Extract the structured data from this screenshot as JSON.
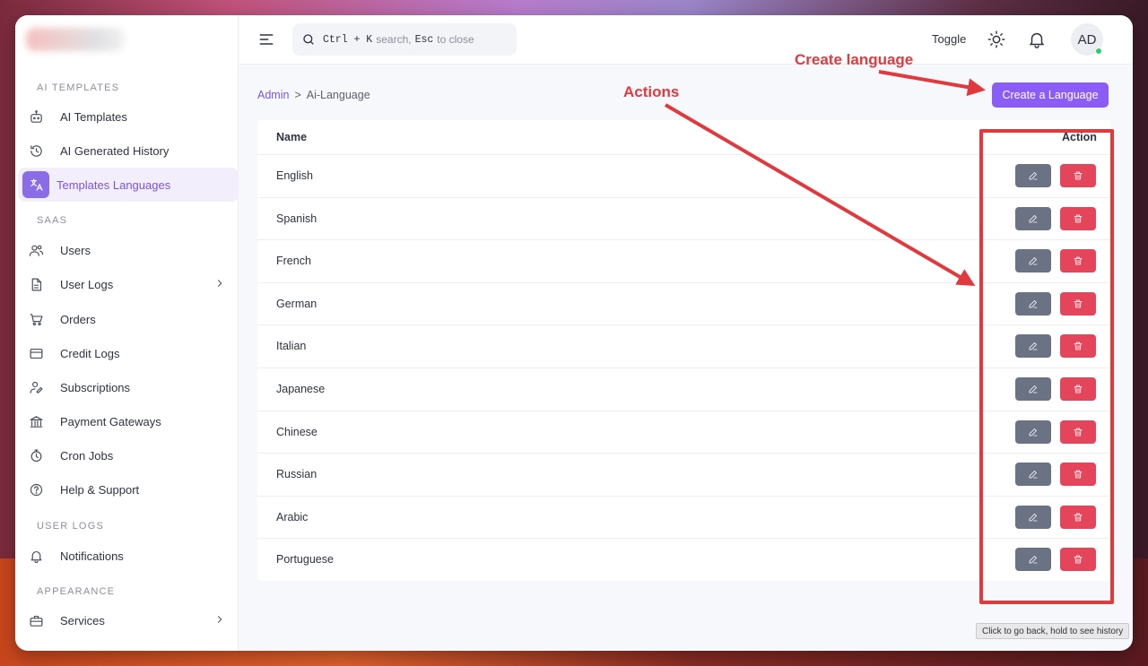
{
  "sidebar": {
    "sections": [
      {
        "label": "AI TEMPLATES"
      },
      {
        "label": "SAAS"
      },
      {
        "label": "USER LOGS"
      },
      {
        "label": "APPEARANCE"
      }
    ],
    "items": [
      {
        "label": "AI Templates",
        "icon": "robot-icon"
      },
      {
        "label": "AI Generated History",
        "icon": "history-icon"
      },
      {
        "label": "Templates Languages",
        "icon": "translate-icon",
        "active": true
      },
      {
        "label": "Users",
        "icon": "users-icon"
      },
      {
        "label": "User Logs",
        "icon": "file-icon",
        "has_submenu": true
      },
      {
        "label": "Orders",
        "icon": "cart-icon"
      },
      {
        "label": "Credit Logs",
        "icon": "credit-card-icon"
      },
      {
        "label": "Subscriptions",
        "icon": "signature-icon"
      },
      {
        "label": "Payment Gateways",
        "icon": "bank-icon"
      },
      {
        "label": "Cron Jobs",
        "icon": "stopwatch-icon"
      },
      {
        "label": "Help & Support",
        "icon": "help-icon"
      },
      {
        "label": "Notifications",
        "icon": "bell-icon"
      },
      {
        "label": "Services",
        "icon": "briefcase-icon",
        "has_submenu": true
      }
    ]
  },
  "header": {
    "search": {
      "key1": "Ctrl + K",
      "text1": "search,",
      "key2": "Esc",
      "text2": "to close"
    },
    "toggle_label": "Toggle",
    "avatar_initials": "AD"
  },
  "breadcrumb": {
    "parent": "Admin",
    "separator": ">",
    "current": "Ai-Language"
  },
  "create_button_label": "Create a Language",
  "table": {
    "columns": {
      "name": "Name",
      "action": "Action"
    },
    "rows": [
      "English",
      "Spanish",
      "French",
      "German",
      "Italian",
      "Japanese",
      "Chinese",
      "Russian",
      "Arabic",
      "Portuguese"
    ]
  },
  "annotations": {
    "create_language": "Create language",
    "actions": "Actions",
    "color": "#e0393e"
  },
  "tooltip": "Click to go back, hold to see history",
  "colors": {
    "accent": "#8b5cf6",
    "edit_button": "#6a7284",
    "delete_button": "#e5455a"
  }
}
